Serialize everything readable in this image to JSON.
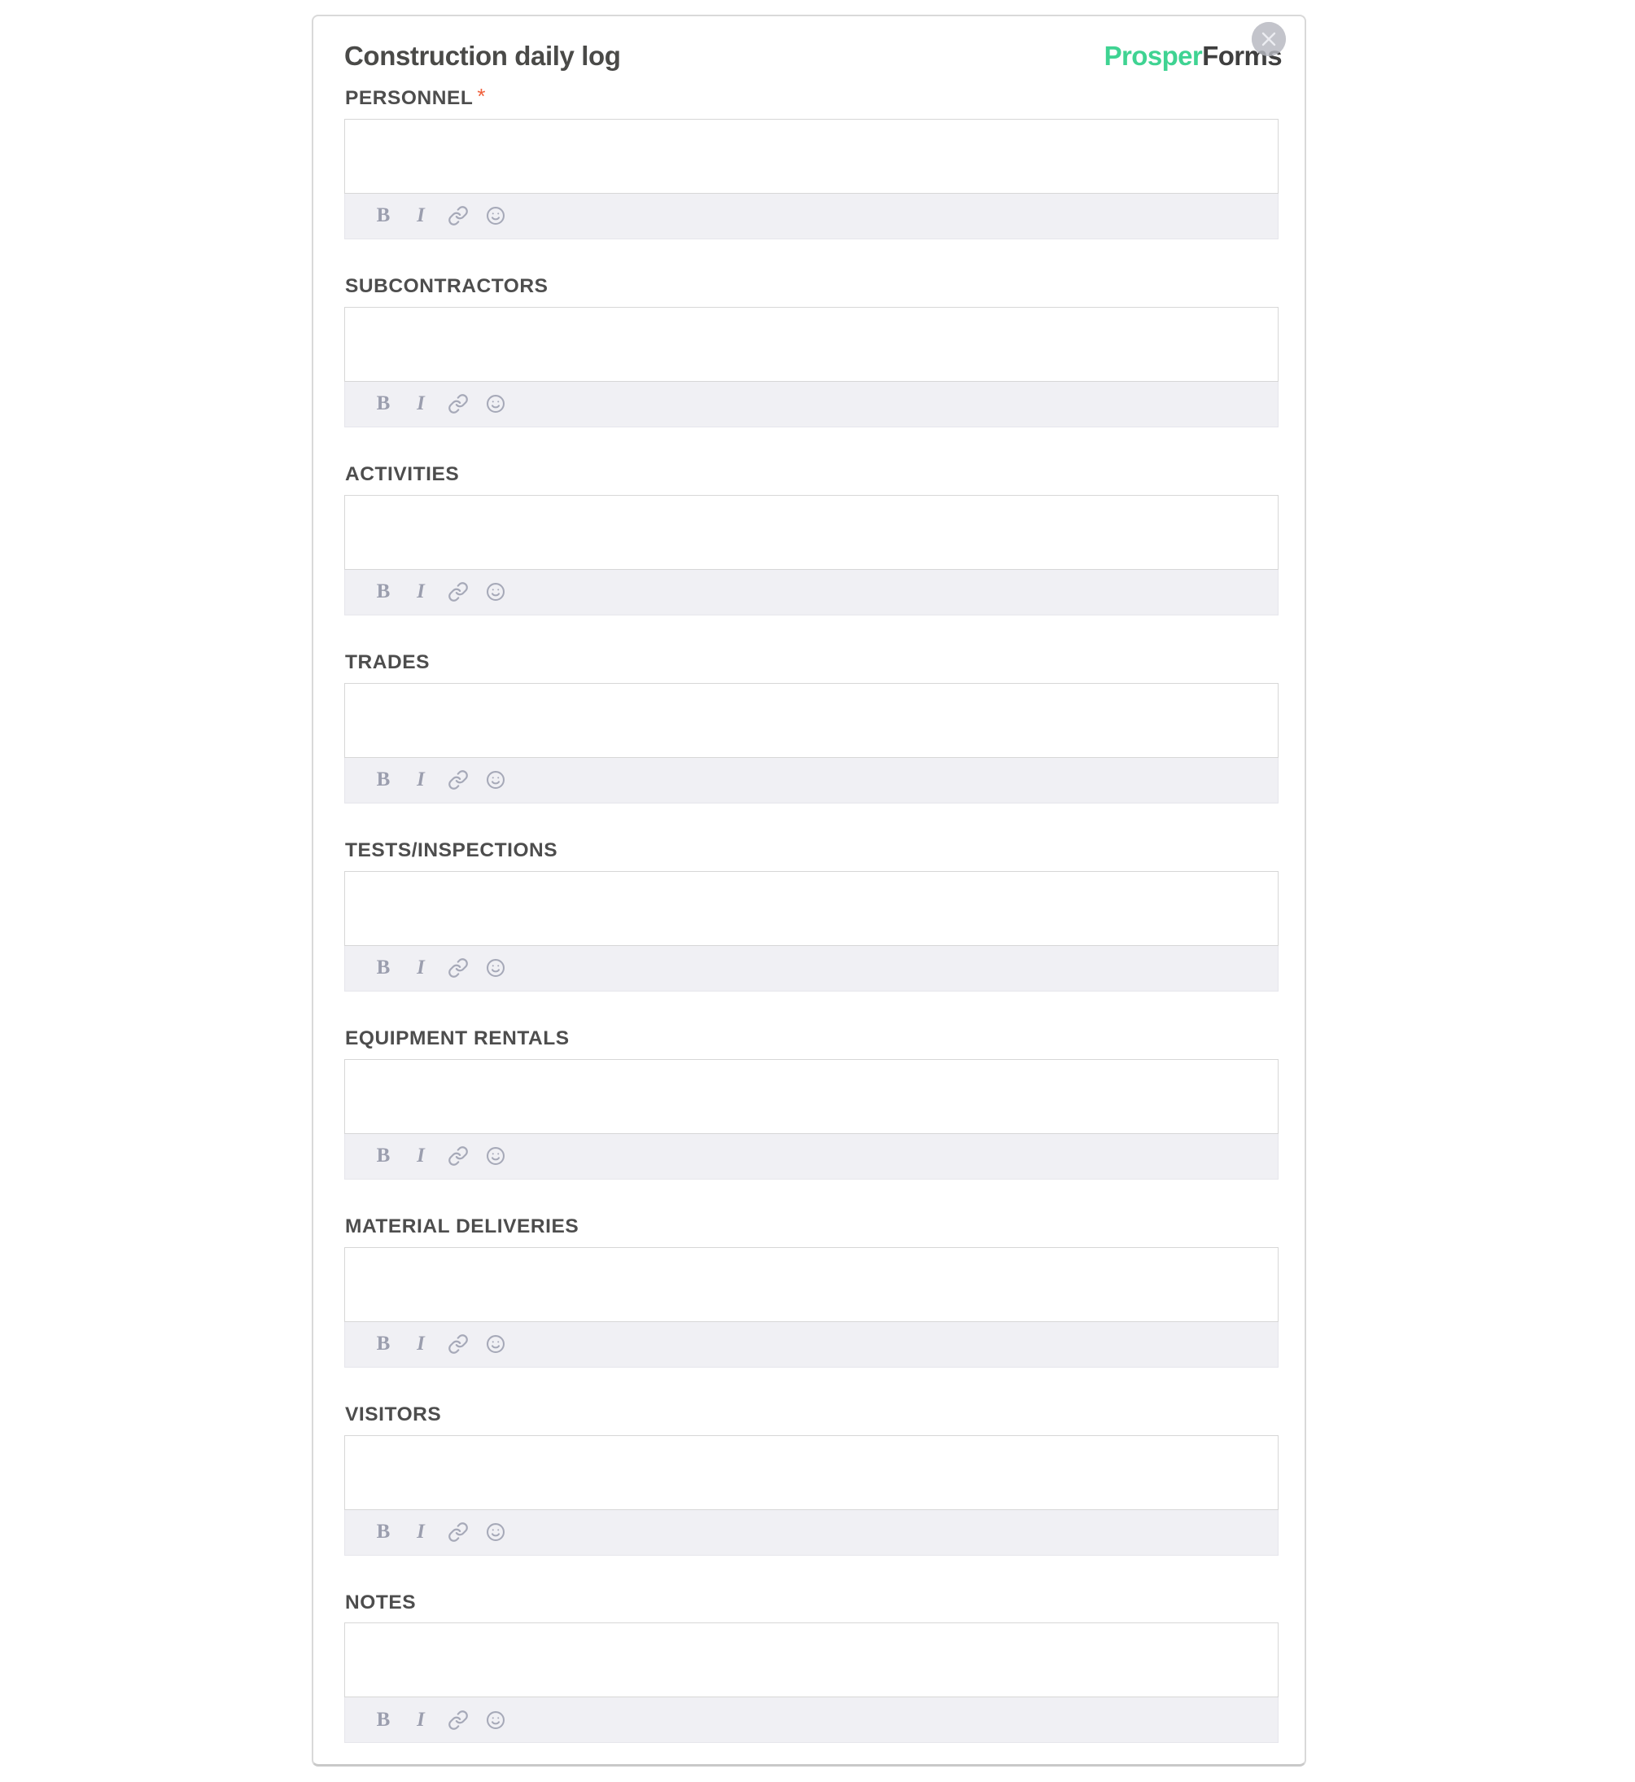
{
  "header": {
    "title": "Construction daily log",
    "brand_prosper": "Prosper",
    "brand_forms": "Forms",
    "close_icon": "close-circle-icon",
    "brand_color": "#3fd392",
    "brand_text_color": "#3f3f3f"
  },
  "toolbar": {
    "bold_label": "B",
    "italic_label": "I",
    "link_icon": "link-icon",
    "emoji_icon": "emoji-smiley-icon"
  },
  "form": {
    "required_marker": "*",
    "required_color": "#f0603c",
    "fields": [
      {
        "label": "PERSONNEL",
        "required": true,
        "value": "",
        "placeholder": ""
      },
      {
        "label": "SUBCONTRACTORS",
        "required": false,
        "value": "",
        "placeholder": ""
      },
      {
        "label": "ACTIVITIES",
        "required": false,
        "value": "",
        "placeholder": ""
      },
      {
        "label": "TRADES",
        "required": false,
        "value": "",
        "placeholder": ""
      },
      {
        "label": "TESTS/INSPECTIONS",
        "required": false,
        "value": "",
        "placeholder": ""
      },
      {
        "label": "EQUIPMENT RENTALS",
        "required": false,
        "value": "",
        "placeholder": ""
      },
      {
        "label": "MATERIAL DELIVERIES",
        "required": false,
        "value": "",
        "placeholder": ""
      },
      {
        "label": "VISITORS",
        "required": false,
        "value": "",
        "placeholder": ""
      },
      {
        "label": "NOTES",
        "required": false,
        "value": "",
        "placeholder": ""
      }
    ]
  }
}
